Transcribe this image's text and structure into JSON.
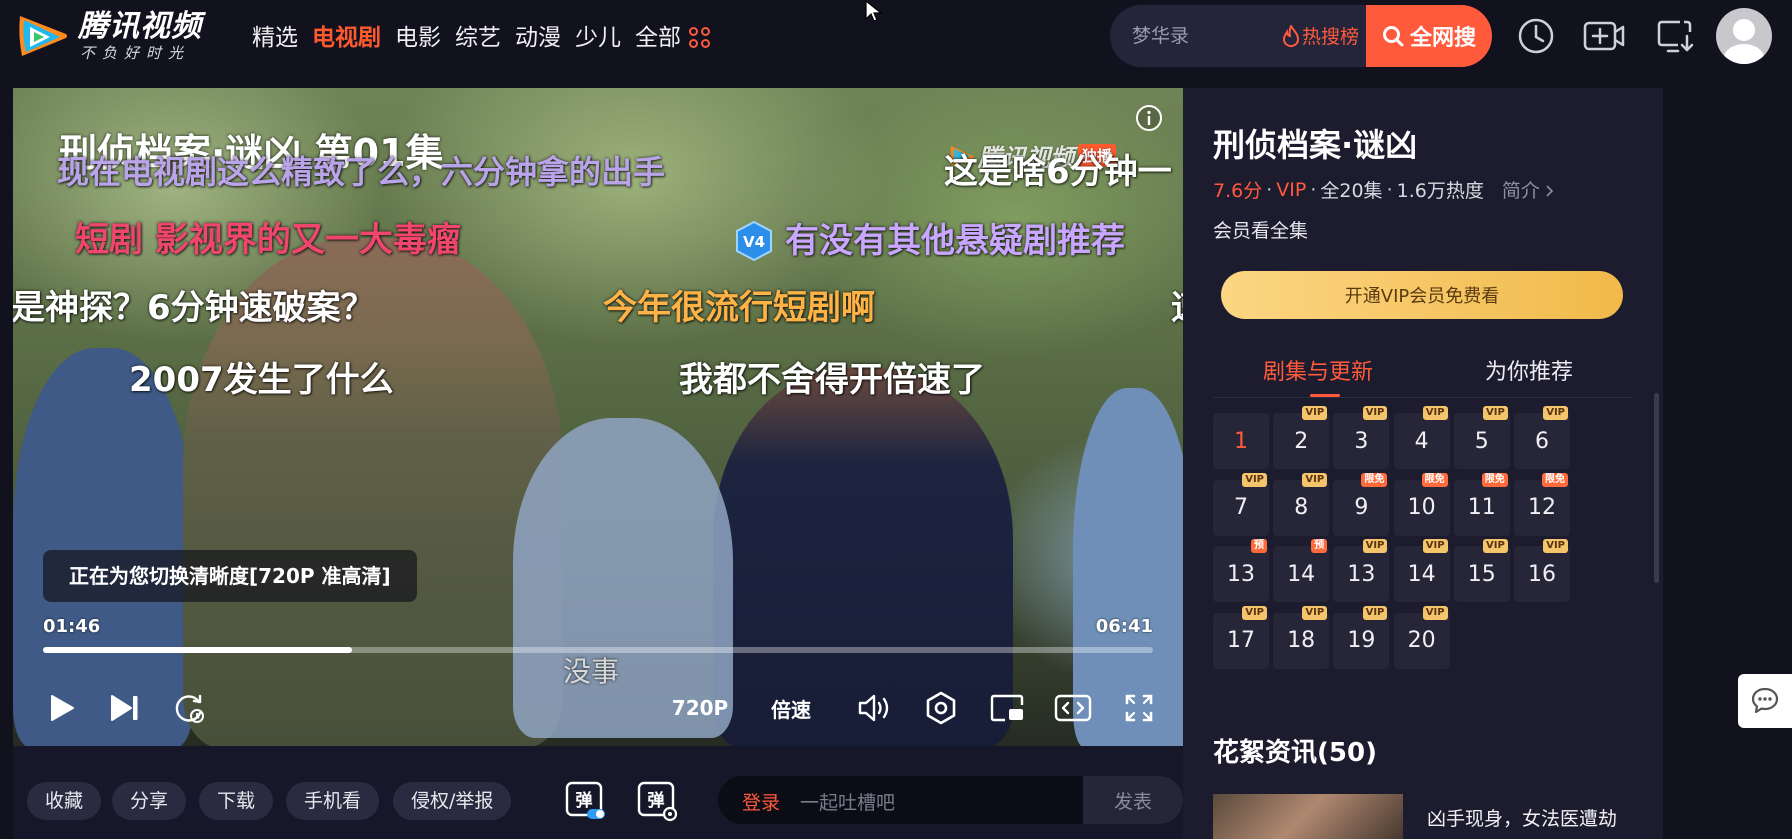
{
  "header": {
    "brand_name": "腾讯视频",
    "brand_slogan": "不负好时光",
    "nav": [
      "精选",
      "电视剧",
      "电影",
      "综艺",
      "动漫",
      "少儿",
      "全部"
    ],
    "active_nav": "电视剧",
    "search_placeholder": "梦华录",
    "hot_label": "热搜榜",
    "search_button": "全网搜",
    "icons": [
      "history-icon",
      "upload-icon",
      "download-icon",
      "avatar"
    ]
  },
  "player": {
    "title": "刑侦档案·谜凶 第01集",
    "watermark": "腾讯视频",
    "watermark_badge": "独播",
    "danmaku": [
      {
        "text": "现在电视剧这么精致了么，六分钟拿的出手",
        "color": "#b9a4ea"
      },
      {
        "text": "这是啥6分钟一 ",
        "color": "#ffffff"
      },
      {
        "text": "短剧 影视界的又一大毒瘤",
        "color": "#f0466e"
      },
      {
        "text": "有没有其他悬疑剧推荐",
        "color": "#c9a6ff"
      },
      {
        "text": "是神探？6分钟速破案？",
        "color": "#ffffff"
      },
      {
        "text": "今年很流行短剧啊",
        "color": "#ffb347"
      },
      {
        "text": "2007发生了什么",
        "color": "#ffffff"
      },
      {
        "text": "我都不舍得开倍速了",
        "color": "#ffffff"
      },
      {
        "text": "速",
        "color": "#ffffff"
      }
    ],
    "vip_level_badge": "V4",
    "toast": "正在为您切换清晰度[720P 准高清]",
    "current_time": "01:46",
    "duration": "06:41",
    "progress": 0.278,
    "subtitle": "没事",
    "quality": "720P",
    "speed": "倍速"
  },
  "actions": {
    "buttons": [
      "收藏",
      "分享",
      "下载",
      "手机看",
      "侵权/举报"
    ],
    "danmaku_toggle_label": "弹",
    "comment_login": "登录",
    "comment_placeholder": "一起吐槽吧",
    "comment_send": "发表"
  },
  "panel": {
    "title": "刑侦档案·谜凶",
    "score": "7.6分",
    "vip": "VIP",
    "episodes_count": "全20集",
    "heat": "1.6万热度",
    "intro": "简介",
    "member_note": "会员看全集",
    "vip_button": "开通VIP会员免费看",
    "tabs": [
      "剧集与更新",
      "为你推荐"
    ],
    "episodes": [
      {
        "num": "1",
        "badge": ""
      },
      {
        "num": "2",
        "badge": "VIP"
      },
      {
        "num": "3",
        "badge": "VIP"
      },
      {
        "num": "4",
        "badge": "VIP"
      },
      {
        "num": "5",
        "badge": "VIP"
      },
      {
        "num": "6",
        "badge": "VIP"
      },
      {
        "num": "7",
        "badge": "VIP"
      },
      {
        "num": "8",
        "badge": "VIP"
      },
      {
        "num": "9",
        "badge": "限免"
      },
      {
        "num": "10",
        "badge": "限免"
      },
      {
        "num": "11",
        "badge": "限免"
      },
      {
        "num": "12",
        "badge": "限免"
      },
      {
        "num": "13",
        "badge": "预"
      },
      {
        "num": "14",
        "badge": "预"
      },
      {
        "num": "13",
        "badge": "VIP"
      },
      {
        "num": "14",
        "badge": "VIP"
      },
      {
        "num": "15",
        "badge": "VIP"
      },
      {
        "num": "16",
        "badge": "VIP"
      },
      {
        "num": "17",
        "badge": "VIP"
      },
      {
        "num": "18",
        "badge": "VIP"
      },
      {
        "num": "19",
        "badge": "VIP"
      },
      {
        "num": "20",
        "badge": "VIP"
      }
    ],
    "news_header": "花絮资讯(50)",
    "news_title": "凶手现身，女法医遭劫持险遇害!"
  },
  "colors": {
    "accent": "#ff5a3c",
    "background": "#12121f",
    "panel": "#1c1c2e",
    "vip_gold": "#f4c56b"
  }
}
